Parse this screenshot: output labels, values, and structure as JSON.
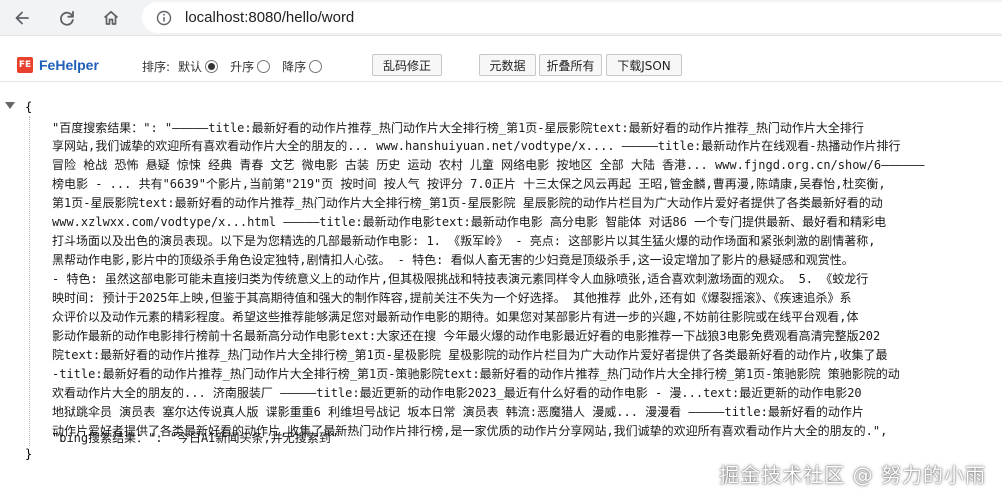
{
  "browser": {
    "url": "localhost:8080/hello/word"
  },
  "toolbar": {
    "brand": "FeHelper",
    "logo_text": "FE",
    "sort_label": "排序:",
    "sort_options": [
      "默认",
      "升序",
      "降序"
    ],
    "selected_sort": "默认",
    "fix_button": "乱码修正",
    "raw_button": "元数据",
    "fold_button": "折叠所有",
    "download_button": "下载JSON"
  },
  "json": {
    "open_brace": "{",
    "close_brace": "}",
    "baidu_key": "\"百度搜索结果：\":",
    "baidu_lines": [
      "\"—————title:最新好看的动作片推荐_热门动作片大全排行榜_第1页-星辰影院text:最新好看的动作片推荐_热门动作片大全排行",
      "享网站,我们诚挚的欢迎所有喜欢看动作片大全的朋友的... www.hanshuiyuan.net/vodtype/x....   —————title:最新动作片在线观看-热播动作片排行",
      "冒险 枪战 恐怖 悬疑 惊悚 经典 青春 文艺 微电影 古装 历史 运动 农村 儿童 网络电影 按地区 全部 大陆 香港... www.fjngd.org.cn/show/6——————",
      "榜电影 - ... 共有\"6639\"个影片,当前第\"219\"页 按时间 按人气 按评分 7.0正片 十三太保之风云再起 王昭,管金麟,曹再漫,陈靖康,吴春怡,杜奕衡,",
      "第1页-星辰影院text:最新好看的动作片推荐_热门动作片大全排行榜_第1页-星辰影院 星辰影院的动作片栏目为广大动作片爱好者提供了各类最新好看的动",
      "www.xzlwxx.com/vodtype/x...html   —————title:最新动作电影text:最新动作电影 高分电影 智能体 对话86 一个专门提供最新、最好看和精彩电",
      "打斗场面以及出色的演员表现。以下是为您精选的几部最新动作电影: 1. 《叛军岭》 - 亮点: 这部影片以其生猛火爆的动作场面和紧张刺激的剧情著称,",
      "黑帮动作电影,影片中的顶级杀手角色设定独特,剧情扣人心弦。 - 特色: 看似人畜无害的少妇竟是顶级杀手,这一设定增加了影片的悬疑感和观赏性。",
      "- 特色: 虽然这部电影可能未直接归类为传统意义上的动作片,但其极限挑战和特技表演元素同样令人血脉喷张,适合喜欢刺激场面的观众。 5. 《蛟龙行",
      "映时间: 预计于2025年上映,但鉴于其高期待值和强大的制作阵容,提前关注不失为一个好选择。 其他推荐 此外,还有如《爆裂摇滚》、《疾速追杀》系",
      "众评价以及动作元素的精彩程度。希望这些推荐能够满足您对最新动作电影的期待。如果您对某部影片有进一步的兴趣,不妨前往影院或在线平台观看,体",
      "影动作最新的动作电影排行榜前十名最新高分动作电影text:大家还在搜 今年最火爆的动作电影最近好看的电影推荐一下战狼3电影免费观看高清完整版202",
      "院text:最新好看的动作片推荐_热门动作片大全排行榜_第1页-星极影院 星极影院的动作片栏目为广大动作片爱好者提供了各类最新好看的动作片,收集了最",
      "-title:最新好看的动作片推荐_热门动作片大全排行榜_第1页-策驰影院text:最新好看的动作片推荐_热门动作片大全排行榜_第1页-策驰影院 策驰影院的动",
      "欢看动作片大全的朋友的... 济南服装厂   —————title:最近更新的动作电影2023_最近有什么好看的动作电影 - 漫...text:最近更新的动作电影20",
      "地狱跳伞员 演员表 塞尔达传说真人版 谍影重重6 利维坦号战记 坂本日常 演员表 韩流:恶魔猎人 漫威... 漫漫看   —————title:最新好看的动作片",
      "动作片爱好者提供了各类最新好看的动作片,收集了最新热门动作片排行榜,是一家优质的动作片分享网站,我们诚挚的欢迎所有喜欢看动作片大全的朋友的.\","
    ],
    "bing_key": "\"bing搜索结果：\":",
    "bing_value": "\"今日AI新闻头条,并无搜索到\""
  },
  "watermark": "掘金技术社区 @ 努力的小雨"
}
